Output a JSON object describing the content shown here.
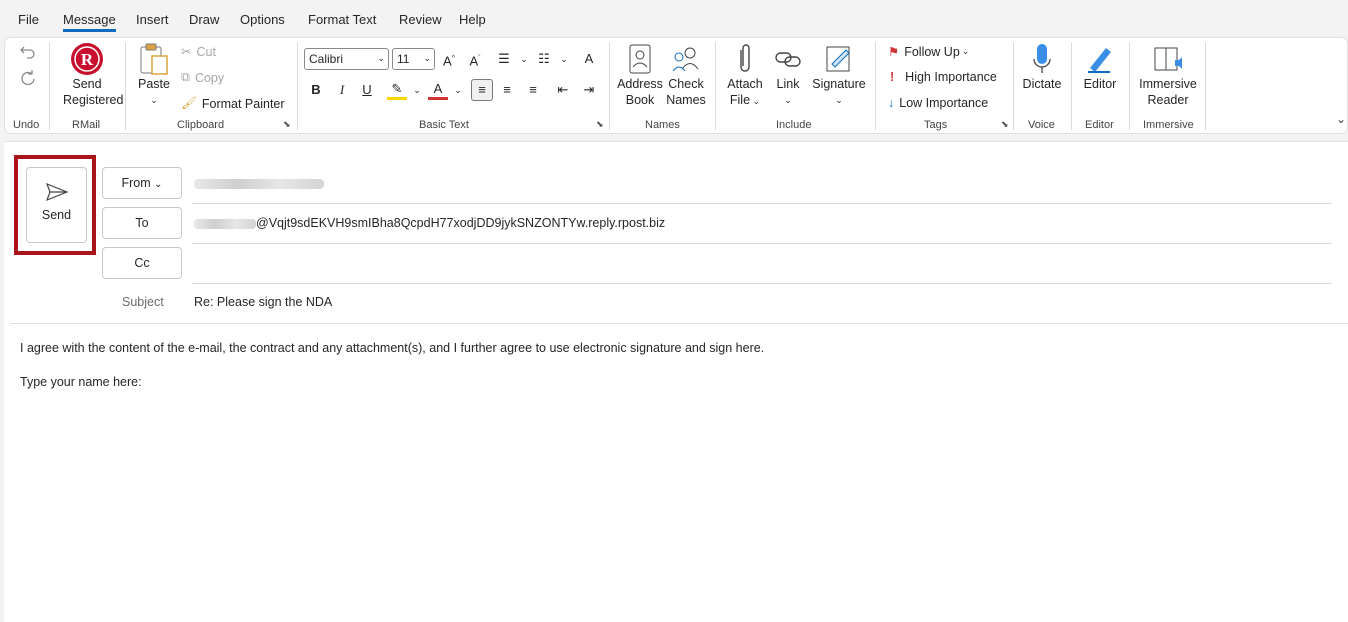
{
  "menu": [
    "File",
    "Message",
    "Insert",
    "Draw",
    "Options",
    "Format Text",
    "Review",
    "Help"
  ],
  "active_menu": "Message",
  "ribbon": {
    "undo_group": "Undo",
    "rmail": {
      "send_registered": "Send Registered",
      "send_line1": "Send",
      "send_line2": "Registered",
      "group": "RMail"
    },
    "clipboard": {
      "paste": "Paste",
      "cut": "Cut",
      "copy": "Copy",
      "format_painter": "Format Painter",
      "group": "Clipboard"
    },
    "basic_text": {
      "font": "Calibri",
      "size": "11",
      "group": "Basic Text"
    },
    "names": {
      "address_line1": "Address",
      "address_line2": "Book",
      "check_line1": "Check",
      "check_line2": "Names",
      "group": "Names"
    },
    "include": {
      "attach_line1": "Attach",
      "attach_line2": "File",
      "link": "Link",
      "signature": "Signature",
      "group": "Include"
    },
    "tags": {
      "follow_up": "Follow Up",
      "high": "High Importance",
      "low": "Low Importance",
      "group": "Tags"
    },
    "voice": {
      "dictate": "Dictate",
      "group": "Voice"
    },
    "editor": {
      "editor": "Editor",
      "group": "Editor"
    },
    "immersive": {
      "line1": "Immersive",
      "line2": "Reader",
      "group": "Immersive"
    }
  },
  "compose": {
    "send": "Send",
    "from_label": "From",
    "to_label": "To",
    "cc_label": "Cc",
    "subject_label": "Subject",
    "to_value": "@Vqjt9sdEKVH9smIBha8QcpdH77xodjDD9jykSNZONTYw.reply.rpost.biz",
    "subject_value": "Re: Please sign the NDA",
    "body_line1": "I agree with the content of the e-mail, the contract and any attachment(s), and I further agree to use electronic signature and sign here.",
    "body_line2": "Type your name here:"
  },
  "colors": {
    "accent": "#0f6cbd",
    "highlight_box": "#a9141b",
    "rmail_red": "#c8102e",
    "flag_red": "#d13438"
  }
}
